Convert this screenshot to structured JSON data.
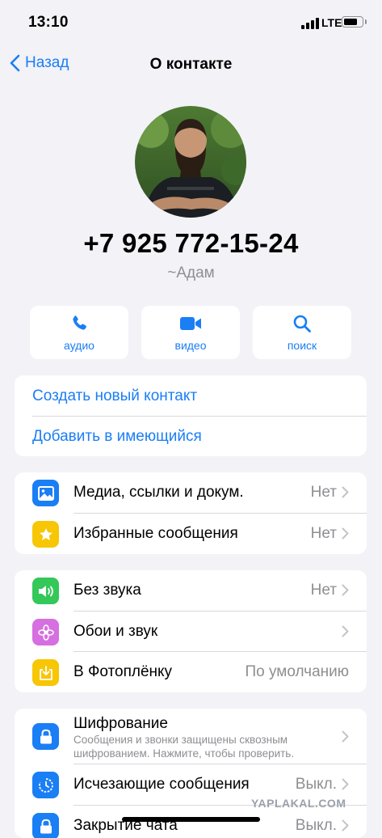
{
  "status": {
    "time": "13:10",
    "network": "LTE"
  },
  "nav": {
    "back_label": "Назад",
    "title": "О контакте"
  },
  "contact": {
    "phone": "+7 925 772-15-24",
    "nickname": "~Адам"
  },
  "actions": [
    {
      "label": "аудио",
      "icon": "phone-icon"
    },
    {
      "label": "видео",
      "icon": "video-icon"
    },
    {
      "label": "поиск",
      "icon": "search-icon"
    }
  ],
  "contact_links": {
    "create": "Создать новый контакт",
    "add_existing": "Добавить в имеющийся"
  },
  "section1": [
    {
      "label": "Медиа, ссылки и докум.",
      "value": "Нет",
      "icon": "photo-icon",
      "color": "#1a7ef5"
    },
    {
      "label": "Избранные сообщения",
      "value": "Нет",
      "icon": "star-icon",
      "color": "#f7c605"
    }
  ],
  "section2": [
    {
      "label": "Без звука",
      "value": "Нет",
      "icon": "speaker-icon",
      "color": "#34c759"
    },
    {
      "label": "Обои и звук",
      "value": "",
      "icon": "flower-icon",
      "color": "#d66fe0"
    },
    {
      "label": "В Фотоплёнку",
      "value": "По умолчанию",
      "icon": "download-icon",
      "color": "#f7c605"
    }
  ],
  "section3": {
    "encryption": {
      "label": "Шифрование",
      "desc_line1": "Сообщения и звонки защищены сквозным",
      "desc_line2": "шифрованием. Нажмите, чтобы проверить.",
      "icon": "lock-icon",
      "color": "#1a7ef5"
    },
    "disappearing": {
      "label": "Исчезающие сообщения",
      "value": "Выкл.",
      "icon": "timer-icon",
      "color": "#1a7ef5"
    },
    "chat_lock": {
      "label": "Закрытие чата",
      "value": "Выкл.",
      "icon": "lock-chat-icon",
      "color": "#1a7ef5"
    }
  },
  "watermark": "YAPLAKAL.COM",
  "colors": {
    "accent": "#1a7ef5",
    "background": "#f2f2f7",
    "secondary_text": "#8e8e93"
  }
}
